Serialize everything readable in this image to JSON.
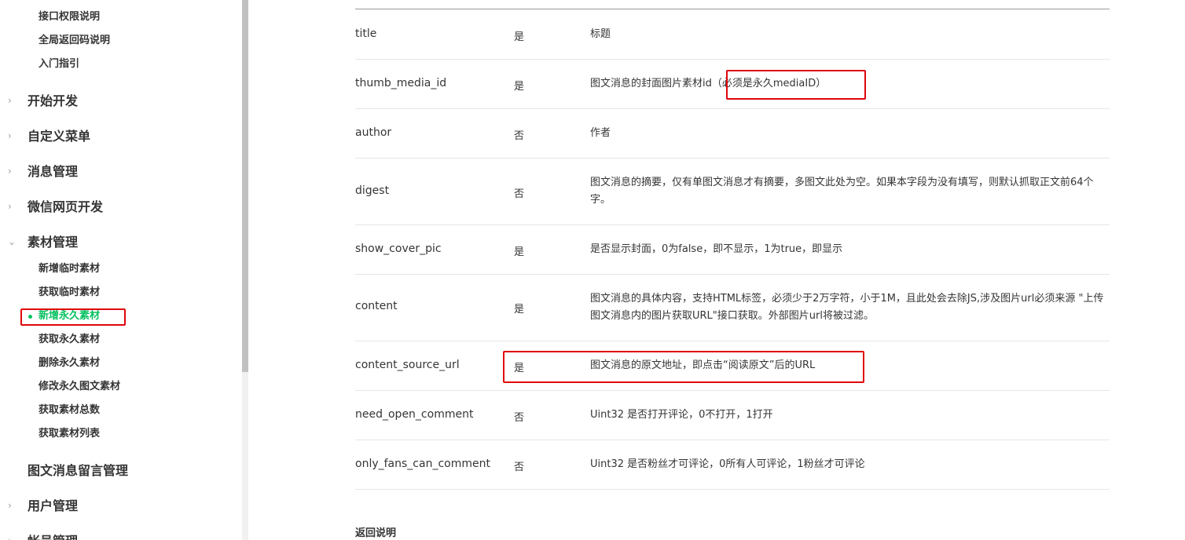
{
  "sidebar": {
    "top_items": [
      "接口权限说明",
      "全局返回码说明",
      "入门指引"
    ],
    "categories_before": [
      "开始开发",
      "自定义菜单",
      "消息管理",
      "微信网页开发",
      "素材管理"
    ],
    "material_items": [
      "新增临时素材",
      "获取临时素材",
      "新增永久素材",
      "获取永久素材",
      "删除永久素材",
      "修改永久图文素材",
      "获取素材总数",
      "获取素材列表"
    ],
    "active_item": "新增永久素材",
    "categories_after": [
      "图文消息留言管理",
      "用户管理",
      "帐号管理"
    ]
  },
  "params": [
    {
      "name": "title",
      "required": "是",
      "desc": "标题"
    },
    {
      "name": "thumb_media_id",
      "required": "是",
      "desc": "图文消息的封面图片素材id（必须是永久mediaID）"
    },
    {
      "name": "author",
      "required": "否",
      "desc": "作者"
    },
    {
      "name": "digest",
      "required": "否",
      "desc": "图文消息的摘要，仅有单图文消息才有摘要，多图文此处为空。如果本字段为没有填写，则默认抓取正文前64个字。"
    },
    {
      "name": "show_cover_pic",
      "required": "是",
      "desc": "是否显示封面，0为false，即不显示，1为true，即显示"
    },
    {
      "name": "content",
      "required": "是",
      "desc": "图文消息的具体内容，支持HTML标签，必须少于2万字符，小于1M，且此处会去除JS,涉及图片url必须来源 \"上传图文消息内的图片获取URL\"接口获取。外部图片url将被过滤。"
    },
    {
      "name": "content_source_url",
      "required": "是",
      "desc": "图文消息的原文地址，即点击“阅读原文”后的URL"
    },
    {
      "name": "need_open_comment",
      "required": "否",
      "desc": "Uint32 是否打开评论，0不打开，1打开"
    },
    {
      "name": "only_fans_can_comment",
      "required": "否",
      "desc": "Uint32 是否粉丝才可评论，0所有人可评论，1粉丝才可评论"
    }
  ],
  "return_section_title": "返回说明",
  "colors": {
    "active": "#07c160",
    "highlight": "#e0060c",
    "text": "#353535"
  }
}
